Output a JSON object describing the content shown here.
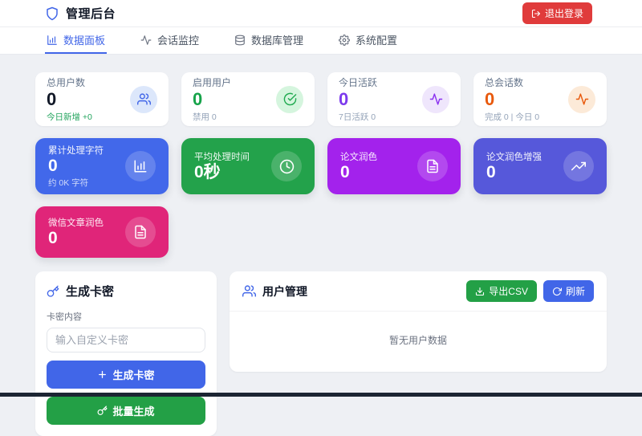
{
  "header": {
    "title": "管理后台",
    "logo_icon": "shield-icon",
    "logout_label": "退出登录",
    "logout_icon": "logout-icon"
  },
  "tabs": [
    {
      "label": "数据面板",
      "icon": "bar-chart-icon",
      "active": true
    },
    {
      "label": "会话监控",
      "icon": "activity-icon",
      "active": false
    },
    {
      "label": "数据库管理",
      "icon": "database-icon",
      "active": false
    },
    {
      "label": "系统配置",
      "icon": "gear-icon",
      "active": false
    }
  ],
  "stats": [
    {
      "label": "总用户数",
      "value": "0",
      "sub": "今日新增 +0",
      "icon": "users-icon"
    },
    {
      "label": "启用用户",
      "value": "0",
      "sub": "禁用 0",
      "icon": "check-circle-icon"
    },
    {
      "label": "今日活跃",
      "value": "0",
      "sub": "7日活跃 0",
      "icon": "activity-icon"
    },
    {
      "label": "总会话数",
      "value": "0",
      "sub": "完成 0 | 今日 0",
      "icon": "activity-icon"
    }
  ],
  "metrics": [
    {
      "label": "累计处理字符",
      "value": "0",
      "sub": "约 0K 字符",
      "icon": "bar-chart-icon",
      "color": "#4268ea"
    },
    {
      "label": "平均处理时间",
      "value": "0秒",
      "sub": "",
      "icon": "clock-icon",
      "color": "#23a24b"
    },
    {
      "label": "论文润色",
      "value": "0",
      "sub": "",
      "icon": "file-text-icon",
      "color": "#a322ec"
    },
    {
      "label": "论文润色增强",
      "value": "0",
      "sub": "",
      "icon": "trending-up-icon",
      "color": "#5658da"
    },
    {
      "label": "微信文章润色",
      "value": "0",
      "sub": "",
      "icon": "file-text-icon",
      "color": "#e02579"
    }
  ],
  "keygen": {
    "title": "生成卡密",
    "title_icon": "key-icon",
    "field_label": "卡密内容",
    "input_value": "",
    "input_placeholder": "输入自定义卡密",
    "generate_label": "生成卡密",
    "batch_label": "批量生成"
  },
  "users": {
    "title": "用户管理",
    "title_icon": "users-icon",
    "export_label": "导出CSV",
    "refresh_label": "刷新",
    "empty_text": "暂无用户数据"
  },
  "colors": {
    "primary_blue": "#4166e8",
    "danger_red": "#e03b3b",
    "button_green": "#23a046",
    "card_blue": "#4268ea",
    "card_green": "#23a24b",
    "card_purple": "#a322ec",
    "card_indigo": "#5658da",
    "card_pink": "#e02579",
    "stat_green": "#16a34a",
    "stat_purple": "#7c3aed",
    "stat_orange": "#e8590c",
    "page_bg": "#eef0f4",
    "footer_dark": "#1c2533"
  }
}
